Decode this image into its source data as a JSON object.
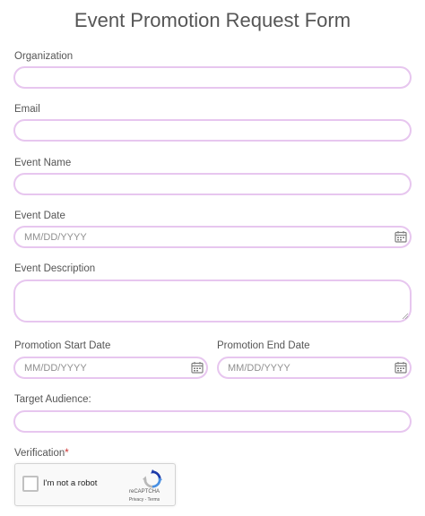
{
  "form": {
    "title": "Event Promotion Request Form",
    "organization_label": "Organization",
    "email_label": "Email",
    "event_name_label": "Event Name",
    "event_date_label": "Event Date",
    "event_date_placeholder": "MM/DD/YYYY",
    "event_description_label": "Event Description",
    "promo_start_label": "Promotion Start Date",
    "promo_start_placeholder": "MM/DD/YYYY",
    "promo_end_label": "Promotion End Date",
    "promo_end_placeholder": "MM/DD/YYYY",
    "target_audience_label": "Target Audience:",
    "verification_label": "Verification",
    "required_mark": "*"
  },
  "captcha": {
    "checkbox_label": "I'm not a robot",
    "brand": "reCAPTCHA",
    "terms": "Privacy - Terms"
  },
  "colors": {
    "field_border": "#e7c6ef",
    "required": "#cc3333",
    "title": "#555555"
  },
  "icons": {
    "calendar": "calendar-icon",
    "recaptcha": "recaptcha-logo-icon",
    "resize": "resize-handle-icon"
  }
}
